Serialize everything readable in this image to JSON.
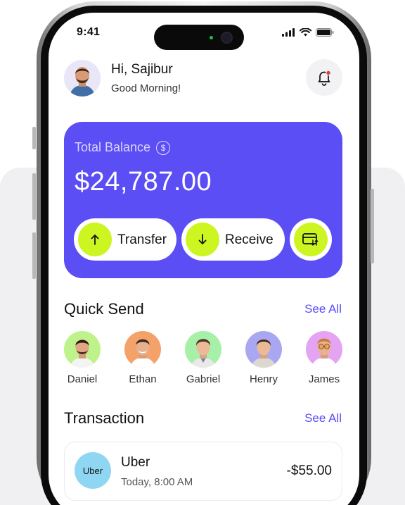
{
  "status": {
    "time": "9:41"
  },
  "header": {
    "greeting": "Hi, Sajibur",
    "subtitle": "Good Morning!"
  },
  "balance": {
    "label": "Total Balance",
    "currency_symbol": "$",
    "amount": "$24,787.00",
    "actions": [
      {
        "label": "Transfer",
        "icon": "arrow-up-icon"
      },
      {
        "label": "Receive",
        "icon": "arrow-down-icon"
      },
      {
        "label": "",
        "icon": "card-exchange-icon"
      }
    ]
  },
  "quick_send": {
    "title": "Quick Send",
    "see_all": "See All",
    "contacts": [
      {
        "name": "Daniel",
        "bg": "#bdf38a"
      },
      {
        "name": "Ethan",
        "bg": "#f4a26a"
      },
      {
        "name": "Gabriel",
        "bg": "#a7f0a8"
      },
      {
        "name": "Henry",
        "bg": "#a9a6f2"
      },
      {
        "name": "James",
        "bg": "#e5a4f2"
      }
    ]
  },
  "transactions": {
    "title": "Transaction",
    "see_all": "See All",
    "items": [
      {
        "logo": "Uber",
        "name": "Uber",
        "time": "Today, 8:00 AM",
        "amount": "-$55.00"
      }
    ]
  },
  "colors": {
    "accent": "#5b4ef5",
    "lime": "#cdf521",
    "uber_bg": "#8fd6f2",
    "notification_dot": "#e23b3b"
  }
}
